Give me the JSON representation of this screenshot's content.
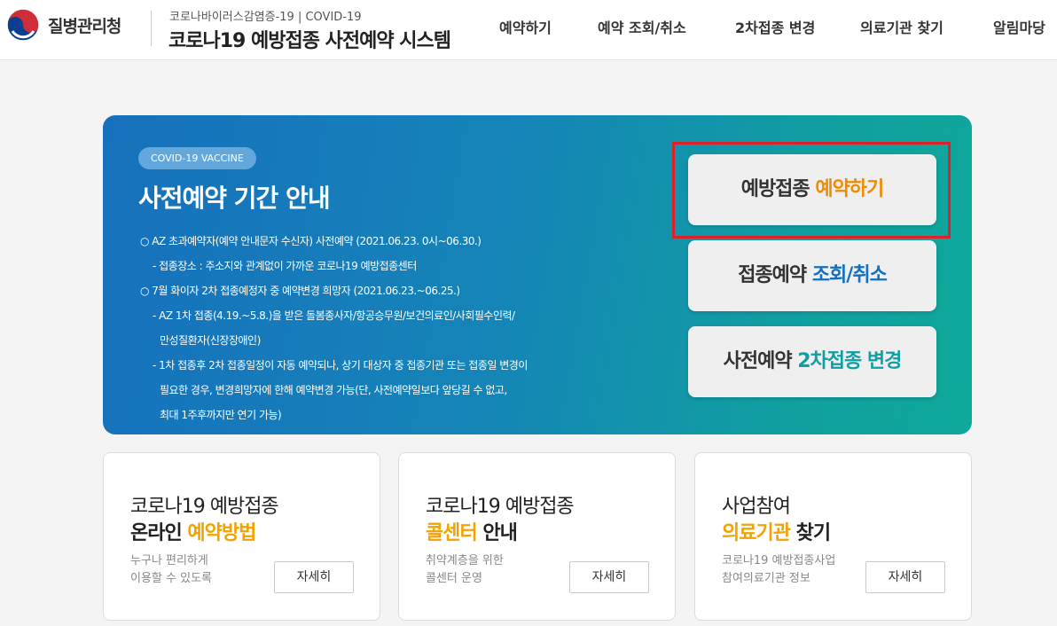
{
  "header": {
    "logo_text": "질병관리청",
    "subtitle": "코로나바이러스감염증-19 | COVID-19",
    "title": "코로나19 예방접종 사전예약 시스템"
  },
  "nav": {
    "items": [
      {
        "label": "예약하기"
      },
      {
        "label": "예약 조회/취소"
      },
      {
        "label": "2차접종 변경"
      },
      {
        "label": "의료기관 찾기"
      },
      {
        "label": "알림마당"
      }
    ]
  },
  "banner": {
    "badge": "COVID-19 VACCINE",
    "title": "사전예약 기간 안내",
    "notices": [
      "○  AZ 초과예약자(예약 안내문자 수신자) 사전예약 (2021.06.23. 0시~06.30.)",
      "- 접종장소 : 주소지와 관계없이 가까운 코로나19 예방접종센터",
      "○  7월 화이자 2차 접종예정자 중 예약변경 희망자 (2021.06.23.~06.25.)",
      "- AZ 1차 접종(4.19.~5.8.)을 받은 돌봄종사자/항공승무원/보건의료인/사회필수인력/",
      "만성질환자(신장장애인)",
      "- 1차 접종후 2차 접종일정이 자동 예약되나, 상기 대상자 중 접종기관 또는 접종일 변경이",
      "필요한 경우, 변경희망자에 한해 예약변경 가능(단, 사전예약일보다 앞당길 수 없고,",
      "최대 1주후까지만 연기 가능)"
    ],
    "buttons": [
      {
        "prefix": "예방접종 ",
        "highlight": "예약하기"
      },
      {
        "prefix": "접종예약 ",
        "highlight": "조회/취소"
      },
      {
        "prefix": "사전예약 ",
        "highlight": "2차접종 변경"
      }
    ]
  },
  "cards": [
    {
      "line1": "코로나19 예방접종",
      "line2_plain": "온라인 ",
      "line2_accent": "예약방법",
      "line2_after": "",
      "desc1": "누구나 편리하게",
      "desc2": "이용할 수 있도록",
      "button": "자세히"
    },
    {
      "line1": "코로나19 예방접종",
      "line2_plain": "",
      "line2_accent": "콜센터",
      "line2_after": " 안내",
      "desc1": "취약계층을 위한",
      "desc2": "콜센터 운영",
      "button": "자세히"
    },
    {
      "line1": "사업참여",
      "line2_plain": "",
      "line2_accent": "의료기관",
      "line2_after": " 찾기",
      "desc1": "코로나19 예방접종사업",
      "desc2": "참여의료기관 정보",
      "button": "자세히"
    }
  ],
  "colors": {
    "highlight_orange": "#f08a00",
    "highlight_blue": "#1270bf",
    "highlight_teal": "#0e9fa4",
    "card_accent": "#f3a300",
    "callout_red": "#d9222a"
  }
}
